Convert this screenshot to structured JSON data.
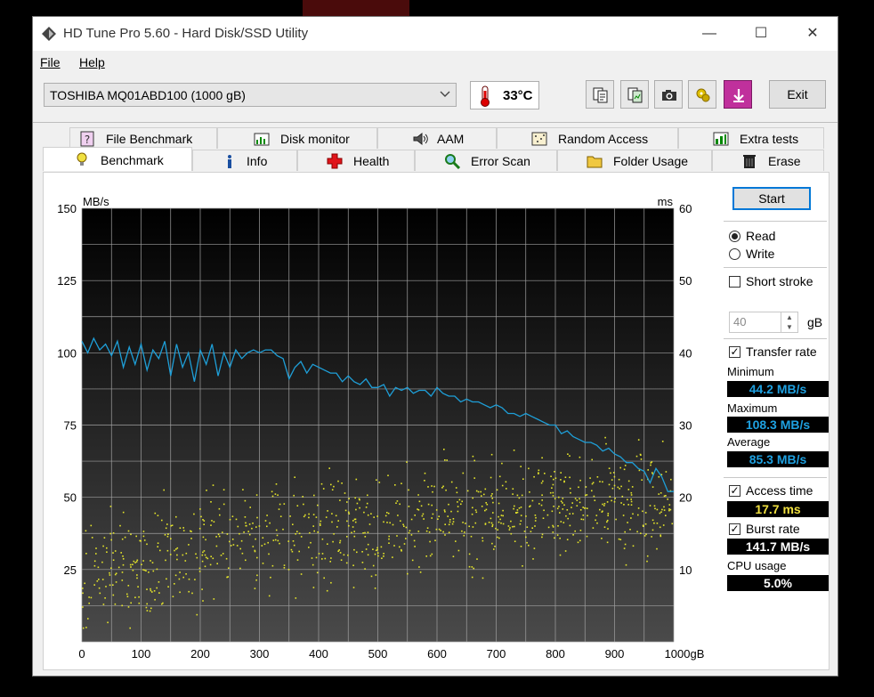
{
  "window": {
    "title": "HD Tune Pro 5.60 - Hard Disk/SSD Utility",
    "controls": {
      "minimize": "—",
      "maximize": "☐",
      "close": "✕"
    }
  },
  "menu": {
    "items": [
      "File",
      "Help"
    ]
  },
  "toolbar": {
    "drive": "TOSHIBA MQ01ABD100 (1000 gB)",
    "temperature": "33°C",
    "exit_label": "Exit",
    "buttons": [
      "copy-text-icon",
      "copy-info-icon",
      "camera-icon",
      "options-icon",
      "save-icon"
    ]
  },
  "tabs": {
    "row1": [
      "File Benchmark",
      "Disk monitor",
      "AAM",
      "Random Access",
      "Extra tests"
    ],
    "row2": [
      "Benchmark",
      "Info",
      "Health",
      "Error Scan",
      "Folder Usage",
      "Erase"
    ],
    "active": "Benchmark"
  },
  "side": {
    "start_label": "Start",
    "read_label": "Read",
    "write_label": "Write",
    "mode_selected": "Read",
    "short_stroke_label": "Short stroke",
    "short_stroke_checked": false,
    "short_stroke_value": "40",
    "short_stroke_unit": "gB",
    "transfer_rate_label": "Transfer rate",
    "transfer_rate_checked": true,
    "minimum_label": "Minimum",
    "minimum_value": "44.2 MB/s",
    "maximum_label": "Maximum",
    "maximum_value": "108.3 MB/s",
    "average_label": "Average",
    "average_value": "85.3 MB/s",
    "access_time_label": "Access time",
    "access_time_checked": true,
    "access_time_value": "17.7 ms",
    "burst_rate_label": "Burst rate",
    "burst_rate_checked": true,
    "burst_rate_value": "141.7 MB/s",
    "cpu_usage_label": "CPU usage",
    "cpu_usage_value": "5.0%"
  },
  "colors": {
    "transfer_line": "#1e9fd8",
    "access_dots": "#e6e62a",
    "plot_top": "#000000",
    "plot_bottom": "#4a4a4a",
    "grid": "#a0a0a0"
  },
  "chart_data": {
    "type": "line",
    "left_unit": "MB/s",
    "right_unit": "ms",
    "x_unit": "gB",
    "xlim": [
      0,
      1000
    ],
    "ylim_left": [
      0,
      150
    ],
    "ylim_right": [
      0,
      60
    ],
    "x_ticks": [
      "0",
      "100",
      "200",
      "300",
      "400",
      "500",
      "600",
      "700",
      "800",
      "900",
      "1000gB"
    ],
    "left_ticks": [
      "25",
      "50",
      "75",
      "100",
      "125",
      "150"
    ],
    "right_ticks": [
      "10",
      "20",
      "30",
      "40",
      "50",
      "60"
    ],
    "grid": true,
    "series": [
      {
        "kind": "transfer_rate",
        "x": [
          0,
          10,
          20,
          30,
          40,
          50,
          60,
          70,
          80,
          90,
          100,
          110,
          120,
          130,
          140,
          150,
          160,
          170,
          180,
          190,
          200,
          210,
          220,
          230,
          240,
          250,
          260,
          270,
          280,
          290,
          300,
          310,
          320,
          330,
          340,
          350,
          360,
          370,
          380,
          390,
          400,
          410,
          420,
          430,
          440,
          450,
          460,
          470,
          480,
          490,
          500,
          510,
          520,
          530,
          540,
          550,
          560,
          570,
          580,
          590,
          600,
          610,
          620,
          630,
          640,
          650,
          660,
          670,
          680,
          690,
          700,
          710,
          720,
          730,
          740,
          750,
          760,
          770,
          780,
          790,
          800,
          810,
          820,
          830,
          840,
          850,
          860,
          870,
          880,
          890,
          900,
          910,
          920,
          930,
          940,
          950,
          960,
          970,
          980,
          990,
          1000
        ],
        "y": [
          104,
          100,
          105,
          101,
          103,
          99,
          104,
          95,
          102,
          96,
          103,
          94,
          101,
          98,
          104,
          92,
          103,
          95,
          100,
          90,
          101,
          96,
          103,
          92,
          100,
          95,
          101,
          98,
          100,
          101,
          100,
          101,
          101,
          99,
          98,
          91,
          95,
          97,
          93,
          96,
          95,
          94,
          93,
          93,
          90,
          92,
          90,
          89,
          91,
          88,
          88,
          89,
          85,
          88,
          87,
          88,
          86,
          87,
          87,
          85,
          88,
          86,
          85,
          85,
          83,
          84,
          83,
          83,
          82,
          81,
          82,
          81,
          79,
          79,
          78,
          79,
          78,
          77,
          76,
          75,
          75,
          72,
          73,
          71,
          70,
          69,
          69,
          68,
          66,
          67,
          65,
          64,
          62,
          62,
          60,
          59,
          55,
          60,
          57,
          52,
          52
        ]
      },
      {
        "kind": "access_time",
        "description": "scatter points, ms on right axis",
        "count": 900
      }
    ]
  }
}
